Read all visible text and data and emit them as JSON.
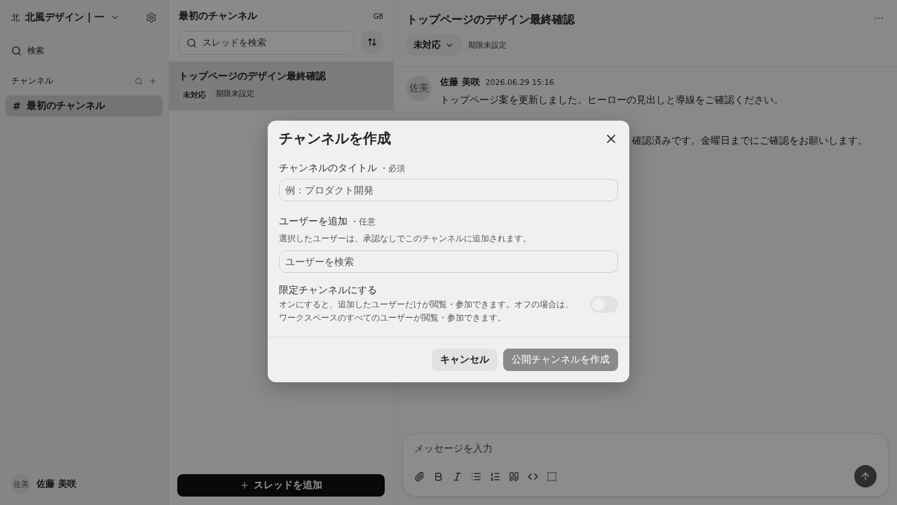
{
  "sidebar": {
    "workspace_initial": "北",
    "workspace": "北風デザイン | 一",
    "search": "検索",
    "section_title": "チャンネル",
    "channels": [
      {
        "prefix": "#",
        "name": "最初のチャンネル",
        "selected": true
      }
    ],
    "user": {
      "initials": "佐美",
      "name": "佐藤 美咲"
    }
  },
  "thread_list": {
    "title": "最初のチャンネル",
    "badge": "G8",
    "search": {
      "placeholder": "スレッドを検索"
    },
    "threads": [
      {
        "title": "トップページのデザイン最終確認",
        "status": "未対応",
        "due": "期限未設定",
        "selected": true
      }
    ],
    "add_button": "スレッドを追加"
  },
  "thread": {
    "title": "トップページのデザイン最終確認",
    "status": "未対応",
    "due": "期限未設定",
    "messages": [
      {
        "initials": "佐美",
        "author": "佐藤 美咲",
        "time": "2026.06.29 15:16",
        "text": "トップページ案を更新しました。ヒーローの見出しと導線をご確認ください。"
      },
      {
        "kind": "partial",
        "text": "確認済みです。金曜日までにご確認をお願いします。"
      }
    ],
    "composer": {
      "placeholder": "メッセージを入力"
    }
  },
  "dialog": {
    "title": "チャンネルを作成",
    "fields": [
      {
        "label": "チャンネルのタイトル",
        "tag": "・必須",
        "placeholder": "例：プロダクト開発"
      },
      {
        "label": "ユーザーを追加",
        "tag": "・任意",
        "hint": "選択したユーザーは、承認なしでこのチャンネルに追加されます。",
        "placeholder": "ユーザーを検索"
      }
    ],
    "restricted": {
      "label": "限定チャンネルにする",
      "description": "オンにすると、追加したユーザーだけが閲覧・参加できます。オフの場合は、ワークスペースのすべてのユーザーが閲覧・参加できます。",
      "on": false
    },
    "cancel": "キャンセル",
    "submit": "公開チャンネルを作成"
  }
}
